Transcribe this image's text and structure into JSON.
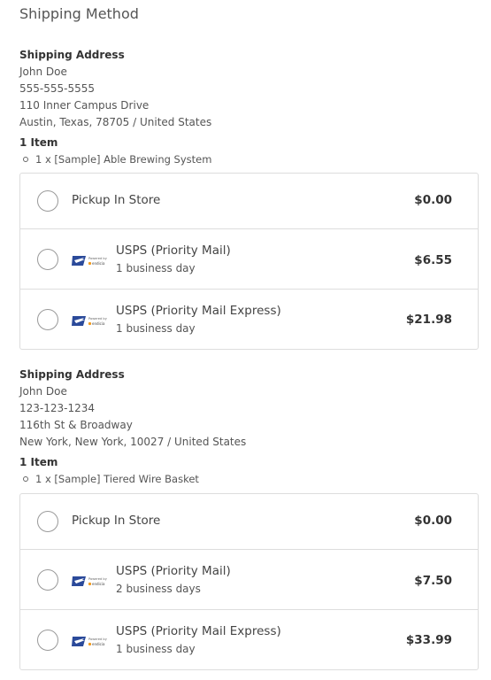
{
  "title": "Shipping Method",
  "shipments": [
    {
      "address_heading": "Shipping Address",
      "name": "John Doe",
      "phone": "555-555-5555",
      "street": "110 Inner Campus Drive",
      "city_line": "Austin, Texas, 78705 / United States",
      "items_heading": "1 Item",
      "items": [
        "1 x [Sample] Able Brewing System"
      ],
      "options": [
        {
          "label": "Pickup In Store",
          "sub": "",
          "price": "$0.00",
          "icon": "none"
        },
        {
          "label": "USPS (Priority Mail)",
          "sub": "1 business day",
          "price": "$6.55",
          "icon": "usps-endicia-logo"
        },
        {
          "label": "USPS (Priority Mail Express)",
          "sub": "1 business day",
          "price": "$21.98",
          "icon": "usps-endicia-logo"
        }
      ]
    },
    {
      "address_heading": "Shipping Address",
      "name": "John Doe",
      "phone": "123-123-1234",
      "street": "116th St & Broadway",
      "city_line": "New York, New York, 10027 / United States",
      "items_heading": "1 Item",
      "items": [
        "1 x [Sample] Tiered Wire Basket"
      ],
      "options": [
        {
          "label": "Pickup In Store",
          "sub": "",
          "price": "$0.00",
          "icon": "none"
        },
        {
          "label": "USPS (Priority Mail)",
          "sub": "2 business days",
          "price": "$7.50",
          "icon": "usps-endicia-logo"
        },
        {
          "label": "USPS (Priority Mail Express)",
          "sub": "1 business day",
          "price": "$33.99",
          "icon": "usps-endicia-logo"
        }
      ]
    }
  ],
  "logo_text": {
    "powered_by": "Powered by",
    "endicia": "endicia"
  },
  "colors": {
    "usps_blue": "#2b4a9a",
    "endicia_orange": "#f29b1d"
  }
}
